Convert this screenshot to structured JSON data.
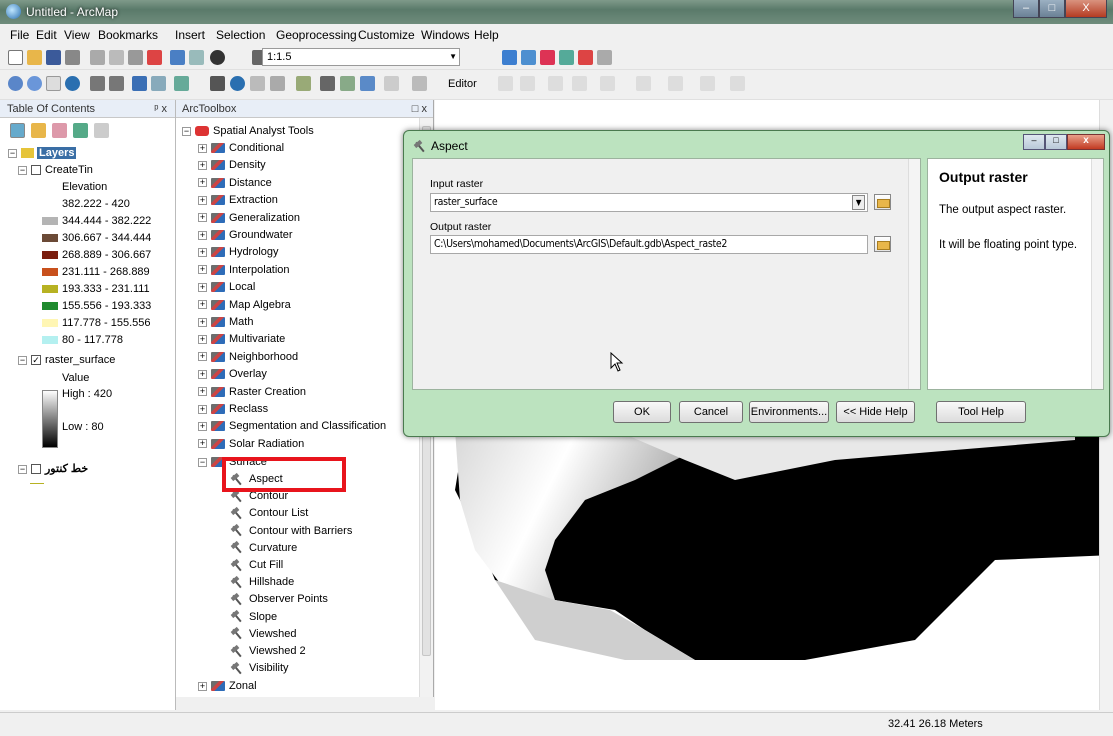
{
  "window": {
    "title": "Untitled - ArcMap",
    "minimize": "–",
    "maximize": "□",
    "close": "X"
  },
  "menu": [
    "File",
    "Edit",
    "View",
    "Bookmarks",
    "Insert",
    "Selection",
    "Geoprocessing",
    "Customize",
    "Windows",
    "Help"
  ],
  "toolbar": {
    "scale": "1:1.5",
    "editor_label": "Editor"
  },
  "toc": {
    "title": "Table Of Contents",
    "pin": "ᵖ x",
    "layers_label": "Layers",
    "createtin": {
      "name": "CreateTin",
      "field": "Elevation",
      "classes": [
        {
          "label": "382.222 - 420",
          "color": "#ffffff"
        },
        {
          "label": "344.444 - 382.222",
          "color": "#b4b4b4"
        },
        {
          "label": "306.667 - 344.444",
          "color": "#6b4a36"
        },
        {
          "label": "268.889 - 306.667",
          "color": "#7a1d0e"
        },
        {
          "label": "231.111 - 268.889",
          "color": "#c8501c"
        },
        {
          "label": "193.333 - 231.111",
          "color": "#b7b222"
        },
        {
          "label": "155.556 - 193.333",
          "color": "#1f8a2e"
        },
        {
          "label": "117.778 - 155.556",
          "color": "#fff6b4"
        },
        {
          "label": "80 - 117.778",
          "color": "#b4f0f0"
        }
      ]
    },
    "raster": {
      "name": "raster_surface",
      "field": "Value",
      "high": "High : 420",
      "low": "Low : 80"
    },
    "contour_layer": "خط کنتور"
  },
  "toolbox": {
    "title": "ArcToolbox",
    "close": "□ x",
    "root": "Spatial Analyst Tools",
    "toolsets": [
      "Conditional",
      "Density",
      "Distance",
      "Extraction",
      "Generalization",
      "Groundwater",
      "Hydrology",
      "Interpolation",
      "Local",
      "Map Algebra",
      "Math",
      "Multivariate",
      "Neighborhood",
      "Overlay",
      "Raster Creation",
      "Reclass",
      "Segmentation and Classification",
      "Solar Radiation",
      "Surface"
    ],
    "surface_tools": [
      "Aspect",
      "Contour",
      "Contour List",
      "Contour with Barriers",
      "Curvature",
      "Cut Fill",
      "Hillshade",
      "Observer Points",
      "Slope",
      "Viewshed",
      "Viewshed 2",
      "Visibility"
    ],
    "after": [
      "Zonal"
    ]
  },
  "dialog": {
    "title": "Aspect",
    "input_label": "Input raster",
    "input_value": "raster_surface",
    "output_label": "Output raster",
    "output_value": "C:\\Users\\mohamed\\Documents\\ArcGIS\\Default.gdb\\Aspect_raste2",
    "buttons": {
      "ok": "OK",
      "cancel": "Cancel",
      "env": "Environments...",
      "hide": "<< Hide Help",
      "toolhelp": "Tool Help"
    },
    "help_title": "Output raster",
    "help_p1": "The output aspect raster.",
    "help_p2": "It will be floating point type."
  },
  "status": {
    "coords": "32.41  26.18 Meters"
  }
}
